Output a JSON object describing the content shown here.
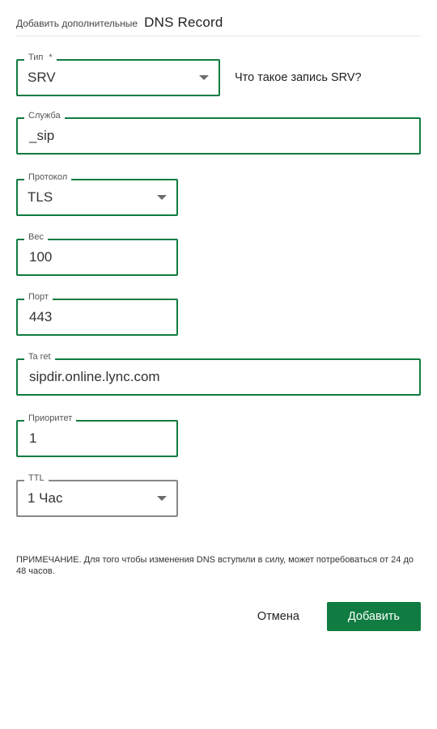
{
  "title": {
    "prefix": "Добавить дополнительные",
    "main": "DNS Record"
  },
  "type": {
    "label": "Тип",
    "required": "*",
    "value": "SRV"
  },
  "helper_link": "Что такое запись SRV?",
  "service": {
    "label": "Служба",
    "value": "_sip"
  },
  "protocol": {
    "label": "Протокол",
    "value": "TLS"
  },
  "weight": {
    "label": "Вес",
    "value": "100"
  },
  "port": {
    "label": "Порт",
    "value": "443"
  },
  "target": {
    "label": "Ta ret",
    "value": "sipdir.online.lync.com"
  },
  "priority": {
    "label": "Приоритет",
    "value": "1"
  },
  "ttl": {
    "label": "TTL",
    "value": "1 Час"
  },
  "note": "ПРИМЕЧАНИЕ. Для того чтобы изменения DNS вступили в силу, может потребоваться от 24 до 48 часов.",
  "buttons": {
    "cancel": "Отмена",
    "submit": "Добавить"
  },
  "colors": {
    "accent": "#107c41"
  }
}
